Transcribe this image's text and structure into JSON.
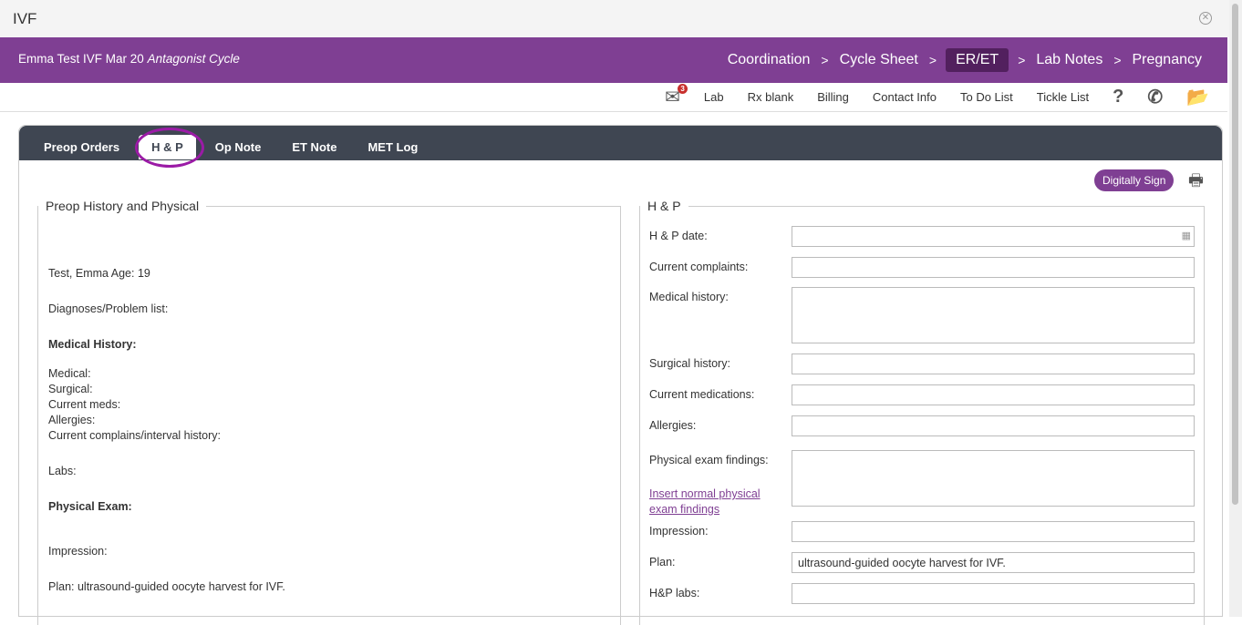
{
  "window": {
    "title": "IVF",
    "close_icon": "close-circle-icon"
  },
  "header": {
    "patient": "Emma Test IVF Mar 20",
    "cycle": "Antagonist Cycle",
    "breadcrumbs": [
      "Coordination",
      "Cycle Sheet",
      "ER/ET",
      "Lab Notes",
      "Pregnancy"
    ],
    "separator": ">",
    "active": "ER/ET"
  },
  "toolbar": {
    "mail_count": "3",
    "items": [
      "Lab",
      "Rx blank",
      "Billing",
      "Contact Info",
      "To Do List",
      "Tickle List"
    ],
    "help": "?"
  },
  "tabs": [
    "Preop Orders",
    "H & P",
    "Op Note",
    "ET Note",
    "MET Log"
  ],
  "actions": {
    "sign": "Digitally Sign"
  },
  "left": {
    "legend": "Preop History and Physical",
    "lines": [
      "Test, Emma Age: 19",
      "Diagnoses/Problem list:",
      "Medical History:",
      "Medical:",
      "Surgical:",
      "Current meds:",
      "Allergies:",
      "Current complains/interval history:",
      "Labs:",
      "Physical Exam:",
      "Impression:",
      "Plan: ultrasound-guided oocyte harvest for IVF."
    ]
  },
  "right": {
    "legend": "H & P",
    "fields": [
      {
        "label": "H & P date:",
        "value": ""
      },
      {
        "label": "Current complaints:",
        "value": ""
      },
      {
        "label": "Medical history:",
        "value": ""
      },
      {
        "label": "Surgical history:",
        "value": ""
      },
      {
        "label": "Current medications:",
        "value": ""
      },
      {
        "label": "Allergies:",
        "value": ""
      },
      {
        "label": "Physical exam findings:",
        "value": ""
      },
      {
        "label": "Impression:",
        "value": ""
      },
      {
        "label": "Plan:",
        "value": "ultrasound-guided oocyte harvest for IVF."
      },
      {
        "label": "H&P labs:",
        "value": ""
      }
    ],
    "insert_link": "Insert normal physical exam findings"
  }
}
